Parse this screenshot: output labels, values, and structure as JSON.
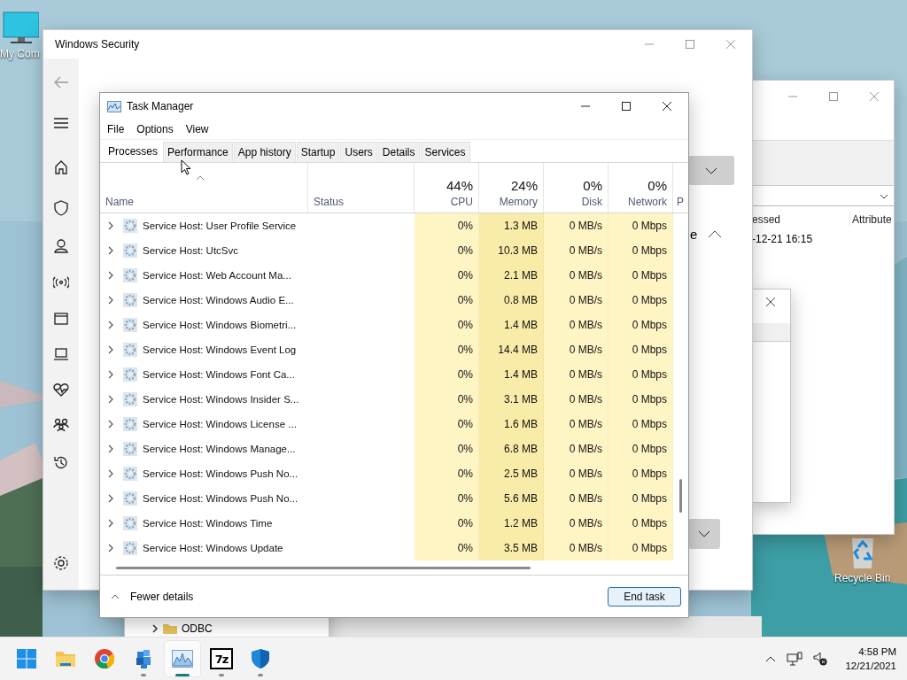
{
  "desktop": {
    "icons": [
      {
        "kind": "computer",
        "label": "My Com"
      },
      {
        "kind": "recycle",
        "label": "Recycle Bin"
      }
    ]
  },
  "registry_window": {
    "tree": [
      {
        "label": "ODBC"
      }
    ]
  },
  "explorer_window": {
    "columns": [
      "essed",
      "Attribute"
    ],
    "rows": [
      {
        "column_1": "-12-21 16:15"
      }
    ]
  },
  "security_window": {
    "title": "Windows Security",
    "partial_label": "e",
    "nav": [
      {
        "kind": "back"
      },
      {
        "kind": "menu"
      },
      {
        "kind": "home"
      },
      {
        "kind": "shield"
      },
      {
        "kind": "person"
      },
      {
        "kind": "antenna"
      },
      {
        "kind": "browser"
      },
      {
        "kind": "laptop"
      },
      {
        "kind": "heart"
      },
      {
        "kind": "family"
      },
      {
        "kind": "history"
      },
      {
        "kind": "settings"
      }
    ]
  },
  "task_manager": {
    "title": "Task Manager",
    "menu": [
      "File",
      "Options",
      "View"
    ],
    "tabs": [
      {
        "label": "Processes",
        "selected": true
      },
      {
        "label": "Performance",
        "selected": false
      },
      {
        "label": "App history",
        "selected": false
      },
      {
        "label": "Startup",
        "selected": false
      },
      {
        "label": "Users",
        "selected": false
      },
      {
        "label": "Details",
        "selected": false
      },
      {
        "label": "Services",
        "selected": false
      }
    ],
    "columns": [
      {
        "kind": "name",
        "label": "Name"
      },
      {
        "kind": "status",
        "label": "Status"
      },
      {
        "kind": "metric",
        "percent": "44%",
        "label": "CPU",
        "color": "#fff4c4"
      },
      {
        "kind": "metric",
        "percent": "24%",
        "label": "Memory",
        "color": "#f9eba8"
      },
      {
        "kind": "metric",
        "percent": "0%",
        "label": "Disk",
        "color": "#fff4c4"
      },
      {
        "kind": "metric",
        "percent": "0%",
        "label": "Network",
        "color": "#fff4c4"
      },
      {
        "kind": "cut",
        "label": "P"
      }
    ],
    "rows": [
      {
        "name": "Service Host: User Profile Service",
        "expanded": false,
        "cpu": "0%",
        "memory": "1.3 MB",
        "disk": "0 MB/s",
        "network": "0 Mbps"
      },
      {
        "name": "Service Host: UtcSvc",
        "expanded": false,
        "cpu": "0%",
        "memory": "10.3 MB",
        "disk": "0 MB/s",
        "network": "0 Mbps"
      },
      {
        "name": "Service Host: Web Account Ma...",
        "expanded": false,
        "cpu": "0%",
        "memory": "2.1 MB",
        "disk": "0 MB/s",
        "network": "0 Mbps"
      },
      {
        "name": "Service Host: Windows Audio E...",
        "expanded": false,
        "cpu": "0%",
        "memory": "0.8 MB",
        "disk": "0 MB/s",
        "network": "0 Mbps"
      },
      {
        "name": "Service Host: Windows Biometri...",
        "expanded": false,
        "cpu": "0%",
        "memory": "1.4 MB",
        "disk": "0 MB/s",
        "network": "0 Mbps"
      },
      {
        "name": "Service Host: Windows Event Log",
        "expanded": false,
        "cpu": "0%",
        "memory": "14.4 MB",
        "disk": "0 MB/s",
        "network": "0 Mbps"
      },
      {
        "name": "Service Host: Windows Font Ca...",
        "expanded": false,
        "cpu": "0%",
        "memory": "1.4 MB",
        "disk": "0 MB/s",
        "network": "0 Mbps"
      },
      {
        "name": "Service Host: Windows Insider S...",
        "expanded": false,
        "cpu": "0%",
        "memory": "3.1 MB",
        "disk": "0 MB/s",
        "network": "0 Mbps"
      },
      {
        "name": "Service Host: Windows License ...",
        "expanded": false,
        "cpu": "0%",
        "memory": "1.6 MB",
        "disk": "0 MB/s",
        "network": "0 Mbps"
      },
      {
        "name": "Service Host: Windows Manage...",
        "expanded": false,
        "cpu": "0%",
        "memory": "6.8 MB",
        "disk": "0 MB/s",
        "network": "0 Mbps"
      },
      {
        "name": "Service Host: Windows Push No...",
        "expanded": false,
        "cpu": "0%",
        "memory": "2.5 MB",
        "disk": "0 MB/s",
        "network": "0 Mbps"
      },
      {
        "name": "Service Host: Windows Push No...",
        "expanded": false,
        "cpu": "0%",
        "memory": "5.6 MB",
        "disk": "0 MB/s",
        "network": "0 Mbps"
      },
      {
        "name": "Service Host: Windows Time",
        "expanded": false,
        "cpu": "0%",
        "memory": "1.2 MB",
        "disk": "0 MB/s",
        "network": "0 Mbps"
      },
      {
        "name": "Service Host: Windows Update",
        "expanded": false,
        "cpu": "0%",
        "memory": "3.5 MB",
        "disk": "0 MB/s",
        "network": "0 Mbps"
      }
    ],
    "footer": {
      "toggle": "Fewer details",
      "button": "End task"
    }
  },
  "taskbar": {
    "apps": [
      {
        "kind": "start",
        "selected": false,
        "running": false
      },
      {
        "kind": "folder",
        "selected": false,
        "running": false
      },
      {
        "kind": "browser",
        "selected": false,
        "running": false
      },
      {
        "kind": "cubes",
        "selected": false,
        "running": true
      },
      {
        "kind": "monitor",
        "selected": true,
        "running": true
      },
      {
        "kind": "archiver",
        "text": "7z",
        "selected": false,
        "running": true
      },
      {
        "kind": "shield",
        "selected": false,
        "running": true
      }
    ],
    "clock": {
      "time": "4:58 PM",
      "date": "12/21/2021"
    }
  }
}
